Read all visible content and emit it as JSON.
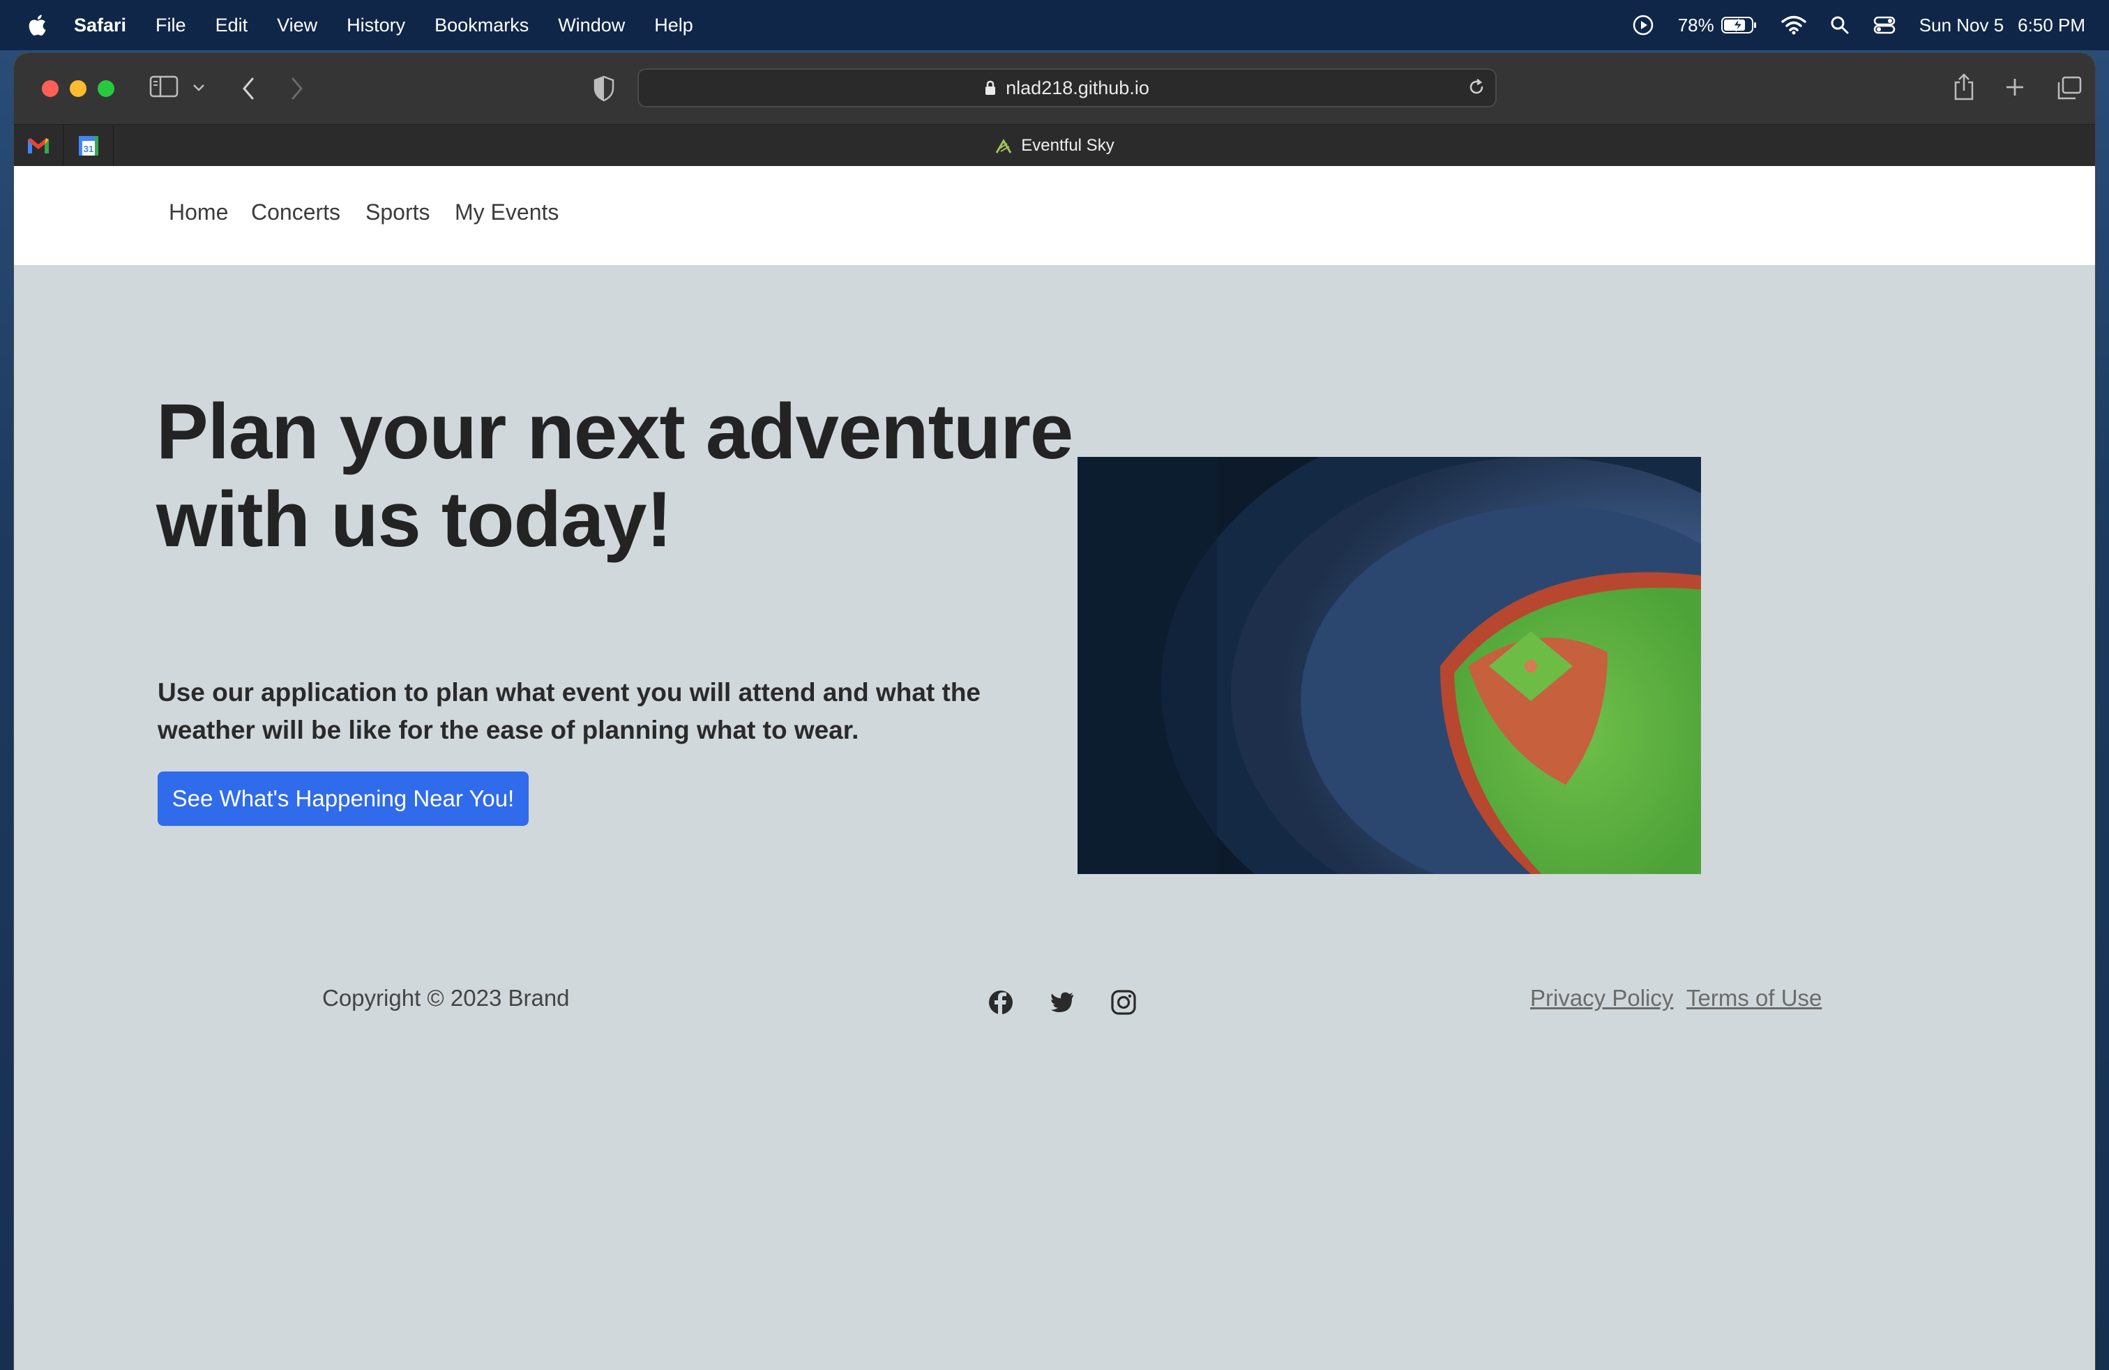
{
  "menubar": {
    "app_name": "Safari",
    "items": [
      "File",
      "Edit",
      "View",
      "History",
      "Bookmarks",
      "Window",
      "Help"
    ],
    "battery": "78%",
    "date": "Sun Nov 5",
    "time": "6:50 PM"
  },
  "browser": {
    "url": "nlad218.github.io",
    "tab_title": "Eventful Sky"
  },
  "nav": {
    "links": [
      "Home",
      "Concerts",
      "Sports",
      "My Events"
    ]
  },
  "hero": {
    "title": "Plan your next adventure with us today!",
    "subtitle": "Use our application to plan what event you will attend and what the weather will be like for the ease of planning what to wear.",
    "cta_label": "See What's Happening Near You!"
  },
  "footer": {
    "copyright": "Copyright © 2023 Brand",
    "privacy": "Privacy Policy",
    "terms": "Terms of Use"
  },
  "colors": {
    "accent": "#2f6bea",
    "page_bg": "#d0d8dc"
  }
}
